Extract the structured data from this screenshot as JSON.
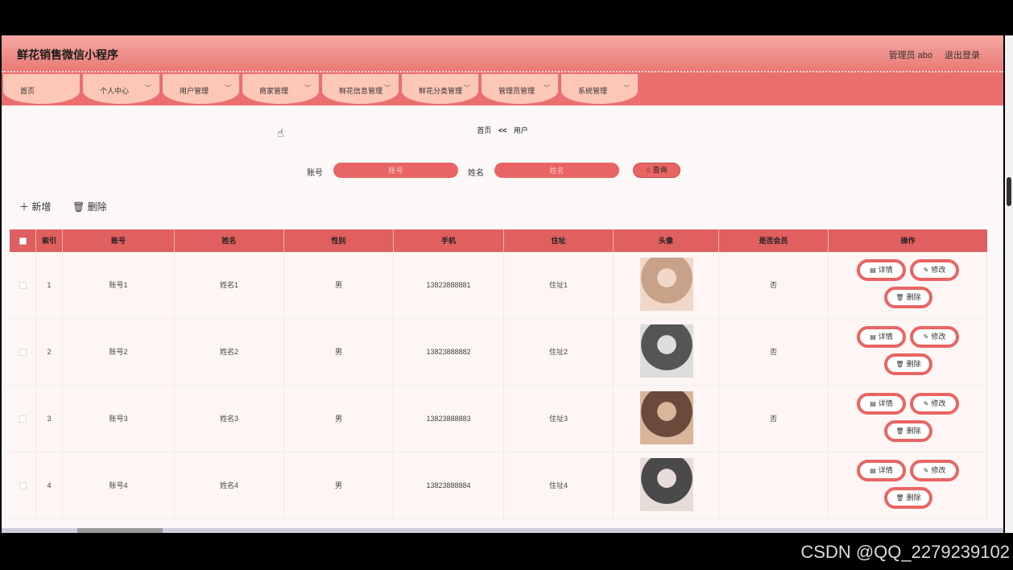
{
  "header": {
    "title": "鲜花销售微信小程序",
    "admin": "管理员 abo",
    "logout": "退出登录"
  },
  "nav": [
    "首页",
    "个人中心",
    "用户管理",
    "商家管理",
    "鲜花信息管理",
    "鲜花分类管理",
    "管理员管理",
    "系统管理"
  ],
  "breadcrumb": {
    "home": "首页",
    "sep": "<<",
    "current": "用户"
  },
  "search": {
    "account_label": "账号",
    "account_placeholder": "账号",
    "name_label": "姓名",
    "name_placeholder": "姓名",
    "button": "查询"
  },
  "actions": {
    "add": "新增",
    "delete": "删除"
  },
  "table": {
    "headers": [
      "索引",
      "账号",
      "姓名",
      "性别",
      "手机",
      "住址",
      "头像",
      "是否会员",
      "操作"
    ],
    "rows": [
      {
        "index": "1",
        "account": "账号1",
        "name": "姓名1",
        "gender": "男",
        "phone": "13823888881",
        "address": "住址1",
        "member": "否"
      },
      {
        "index": "2",
        "account": "账号2",
        "name": "姓名2",
        "gender": "男",
        "phone": "13823888882",
        "address": "住址2",
        "member": "否"
      },
      {
        "index": "3",
        "account": "账号3",
        "name": "姓名3",
        "gender": "男",
        "phone": "13823888883",
        "address": "住址3",
        "member": "否"
      },
      {
        "index": "4",
        "account": "账号4",
        "name": "姓名4",
        "gender": "男",
        "phone": "13823888884",
        "address": "住址4",
        "member": ""
      }
    ],
    "row_buttons": {
      "detail": "详情",
      "edit": "修改",
      "delete": "删除"
    }
  },
  "watermark": "CSDN @QQ_2279239102",
  "colors": {
    "accent": "#e86563",
    "nav_tab": "#fdc7b7",
    "header_bg": "#ea7a76"
  }
}
